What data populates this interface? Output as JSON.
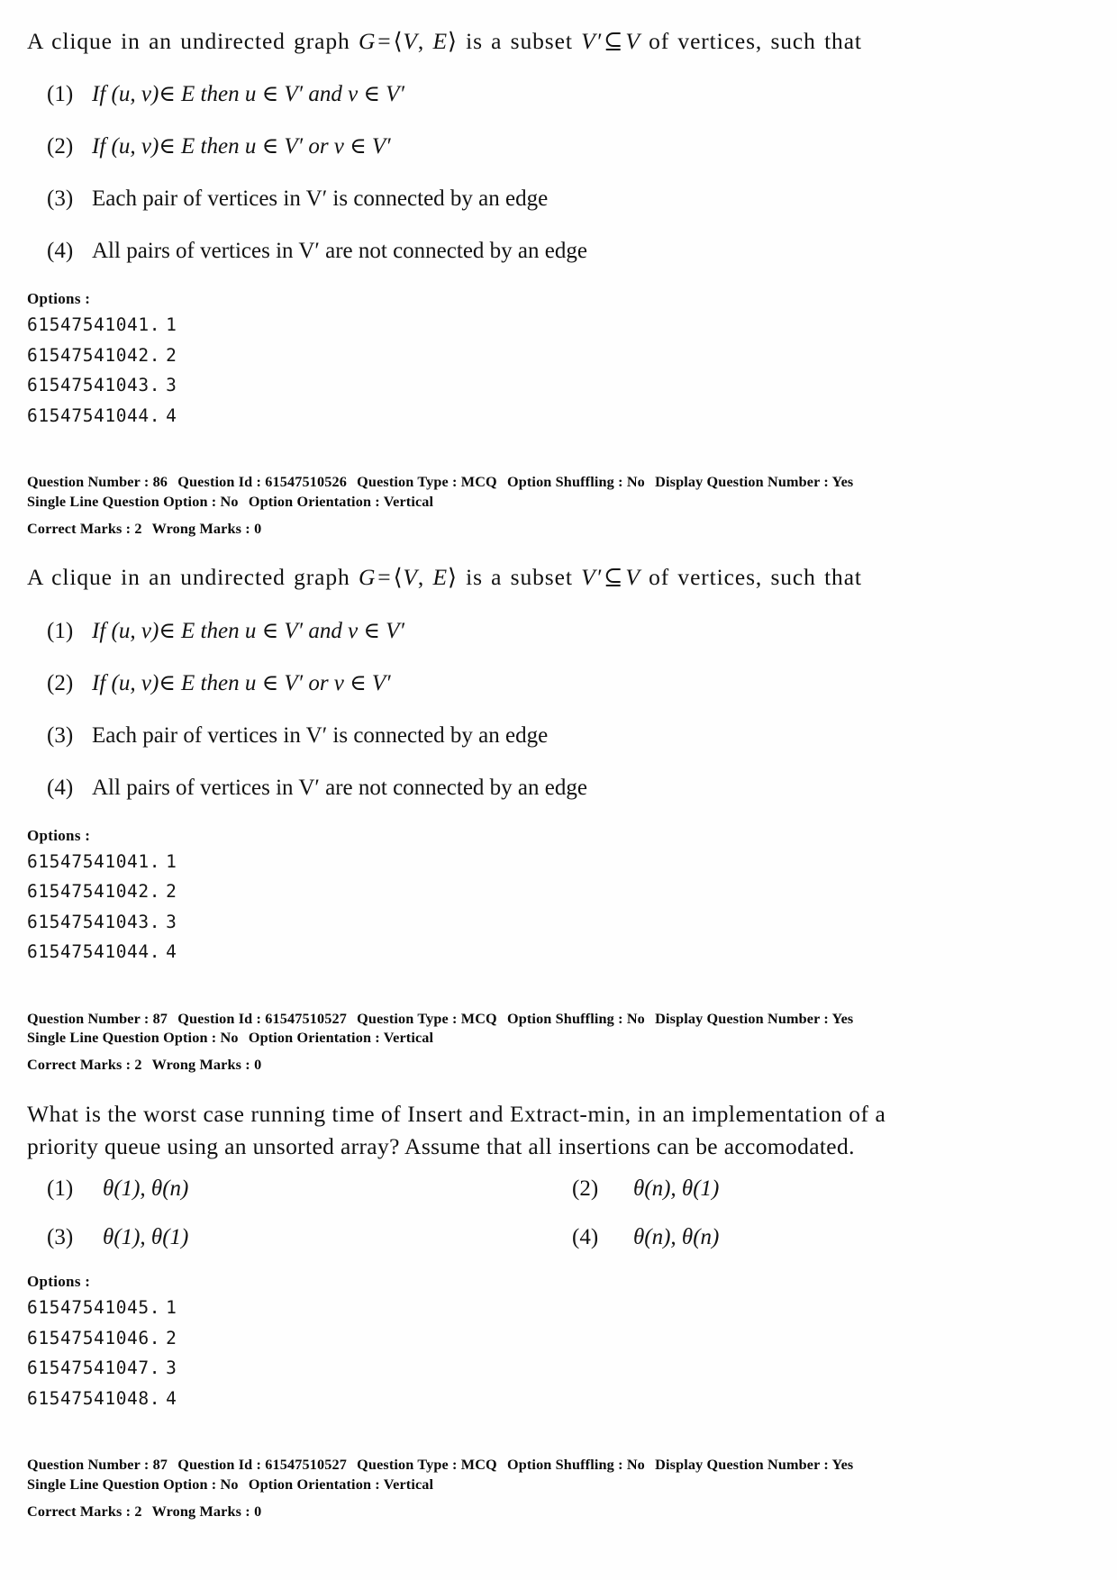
{
  "document": {
    "type": "exam-answer-key-page"
  },
  "blocks": [
    {
      "id": "block-1",
      "stem": {
        "prefix": "A clique in an undirected graph ",
        "g": "G",
        "eq": "=",
        "tuple_open": "⟨",
        "v": "V",
        "comma": ",",
        "e": "E",
        "tuple_close": "⟩",
        "mid": " is a subset ",
        "vprime": "V′",
        "subset": "⊆",
        "v2": "V",
        "suffix": " of vertices, such that"
      },
      "choices": [
        {
          "num": "(1)",
          "text": "If (u, v)∈ E  then  u ∈ V′  and  v ∈ V′"
        },
        {
          "num": "(2)",
          "text": "If (u, v)∈ E  then  u ∈ V′  or  v ∈ V′"
        },
        {
          "num": "(3)",
          "text": "Each pair of vertices in  V′  is connected by an edge"
        },
        {
          "num": "(4)",
          "text": "All pairs of vertices in  V′   are not connected by an edge"
        }
      ],
      "options_label": "Options :",
      "options": [
        {
          "id": "61547541041.",
          "num": "1"
        },
        {
          "id": "61547541042.",
          "num": "2"
        },
        {
          "id": "61547541043.",
          "num": "3"
        },
        {
          "id": "61547541044.",
          "num": "4"
        }
      ]
    },
    {
      "id": "block-2",
      "stem": {
        "prefix": "A clique in an undirected graph ",
        "g": "G",
        "eq": "=",
        "tuple_open": "⟨",
        "v": "V",
        "comma": ",",
        "e": "E",
        "tuple_close": "⟩",
        "mid": " is a subset ",
        "vprime": "V′",
        "subset": "⊆",
        "v2": "V",
        "suffix": " of vertices, such that"
      },
      "choices": [
        {
          "num": "(1)",
          "text": "If (u, v)∈ E  then  u ∈ V′  and  v ∈ V′"
        },
        {
          "num": "(2)",
          "text": "If (u, v)∈ E  then  u ∈ V′  or  v ∈ V′"
        },
        {
          "num": "(3)",
          "text": "Each pair of vertices in  V′  is connected by an edge"
        },
        {
          "num": "(4)",
          "text": "All pairs of vertices in  V′   are not connected by an edge"
        }
      ],
      "options_label": "Options :",
      "options": [
        {
          "id": "61547541041.",
          "num": "1"
        },
        {
          "id": "61547541042.",
          "num": "2"
        },
        {
          "id": "61547541043.",
          "num": "3"
        },
        {
          "id": "61547541044.",
          "num": "4"
        }
      ]
    }
  ],
  "meta_86": {
    "question_number_label": "Question Number :",
    "question_number": "86",
    "question_id_label": "Question Id :",
    "question_id": "61547510526",
    "question_type_label": "Question Type :",
    "question_type": "MCQ",
    "option_shuffling_label": "Option Shuffling :",
    "option_shuffling": "No",
    "display_question_number_label": "Display Question Number :",
    "display_question_number": "Yes",
    "single_line_label": "Single Line Question Option :",
    "single_line": "No",
    "option_orientation_label": "Option Orientation :",
    "option_orientation": "Vertical",
    "correct_marks_label": "Correct Marks :",
    "correct_marks": "2",
    "wrong_marks_label": "Wrong Marks :",
    "wrong_marks": "0"
  },
  "meta_87_a": {
    "question_number_label": "Question Number :",
    "question_number": "87",
    "question_id_label": "Question Id :",
    "question_id": "61547510527",
    "question_type_label": "Question Type :",
    "question_type": "MCQ",
    "option_shuffling_label": "Option Shuffling :",
    "option_shuffling": "No",
    "display_question_number_label": "Display Question Number :",
    "display_question_number": "Yes",
    "single_line_label": "Single Line Question Option :",
    "single_line": "No",
    "option_orientation_label": "Option Orientation :",
    "option_orientation": "Vertical",
    "correct_marks_label": "Correct Marks :",
    "correct_marks": "2",
    "wrong_marks_label": "Wrong Marks :",
    "wrong_marks": "0"
  },
  "meta_87_b": {
    "question_number_label": "Question Number :",
    "question_number": "87",
    "question_id_label": "Question Id :",
    "question_id": "61547510527",
    "question_type_label": "Question Type :",
    "question_type": "MCQ",
    "option_shuffling_label": "Option Shuffling :",
    "option_shuffling": "No",
    "display_question_number_label": "Display Question Number :",
    "display_question_number": "Yes",
    "single_line_label": "Single Line Question Option :",
    "single_line": "No",
    "option_orientation_label": "Option Orientation :",
    "option_orientation": "Vertical",
    "correct_marks_label": "Correct Marks :",
    "correct_marks": "2",
    "wrong_marks_label": "Wrong Marks :",
    "wrong_marks": "0"
  },
  "pq_question": {
    "line1": "What is the worst case running time of Insert and Extract-min, in an implementation of a",
    "line2": "priority queue using an unsorted array? Assume that all insertions can be accomodated.",
    "choices": [
      {
        "num": "(1)",
        "text": "θ(1), θ(n)"
      },
      {
        "num": "(2)",
        "text": "θ(n), θ(1)"
      },
      {
        "num": "(3)",
        "text": "θ(1), θ(1)"
      },
      {
        "num": "(4)",
        "text": "θ(n), θ(n)"
      }
    ],
    "options_label": "Options :",
    "options": [
      {
        "id": "61547541045.",
        "num": "1"
      },
      {
        "id": "61547541046.",
        "num": "2"
      },
      {
        "id": "61547541047.",
        "num": "3"
      },
      {
        "id": "61547541048.",
        "num": "4"
      }
    ]
  }
}
